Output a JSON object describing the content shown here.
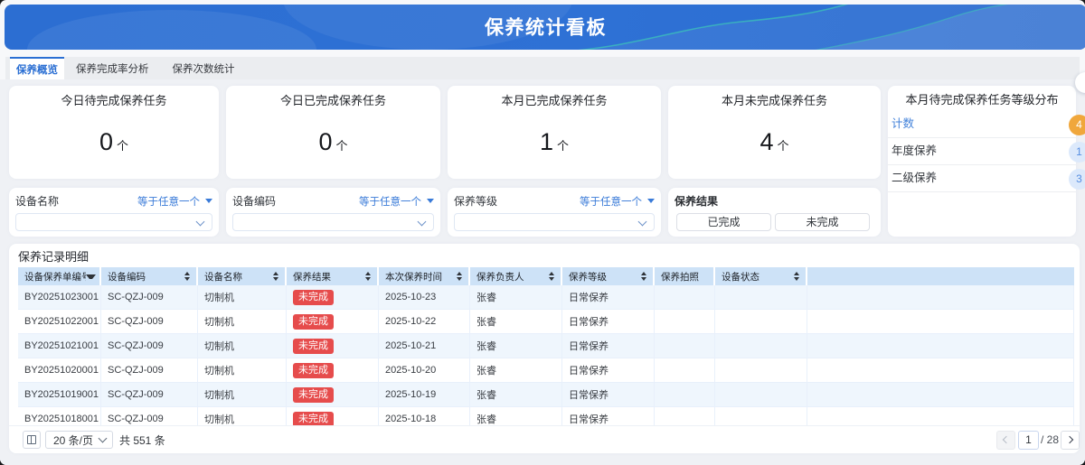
{
  "header": {
    "title": "保养统计看板"
  },
  "tabs": [
    {
      "label": "保养概览",
      "active": true
    },
    {
      "label": "保养完成率分析",
      "active": false
    },
    {
      "label": "保养次数统计",
      "active": false
    }
  ],
  "stats": [
    {
      "title": "今日待完成保养任务",
      "value": "0",
      "unit": "个"
    },
    {
      "title": "今日已完成保养任务",
      "value": "0",
      "unit": "个"
    },
    {
      "title": "本月已完成保养任务",
      "value": "1",
      "unit": "个"
    },
    {
      "title": "本月未完成保养任务",
      "value": "4",
      "unit": "个"
    }
  ],
  "distribution": {
    "title": "本月待完成保养任务等级分布",
    "rows": [
      {
        "label": "计数",
        "count": "4",
        "badge_color": "#f0a73c"
      },
      {
        "label": "年度保养",
        "count": "1",
        "badge_color": "#dce9fb"
      },
      {
        "label": "二级保养",
        "count": "3",
        "badge_color": "#dce9fb"
      }
    ]
  },
  "filters": [
    {
      "label": "设备名称",
      "operator": "等于任意一个",
      "value": ""
    },
    {
      "label": "设备编码",
      "operator": "等于任意一个",
      "value": ""
    },
    {
      "label": "保养等级",
      "operator": "等于任意一个",
      "value": ""
    }
  ],
  "result_filter": {
    "label": "保养结果",
    "buttons": [
      "已完成",
      "未完成"
    ]
  },
  "table": {
    "title": "保养记录明细",
    "columns": [
      {
        "label": "设备保养单编号",
        "sort_icon": "caret-down"
      },
      {
        "label": "设备编码",
        "sort_icon": "sort-both"
      },
      {
        "label": "设备名称",
        "sort_icon": "sort-both"
      },
      {
        "label": "保养结果",
        "sort_icon": "sort-both"
      },
      {
        "label": "本次保养时间",
        "sort_icon": "sort-both"
      },
      {
        "label": "保养负责人",
        "sort_icon": "sort-both"
      },
      {
        "label": "保养等级",
        "sort_icon": "sort-both"
      },
      {
        "label": "保养拍照",
        "sort_icon": "none"
      },
      {
        "label": "设备状态",
        "sort_icon": "sort-both"
      }
    ],
    "rows": [
      {
        "order_no": "BY20251023001",
        "device_code": "SC-QZJ-009",
        "device_name": "切制机",
        "result": "未完成",
        "time": "2025-10-23",
        "owner": "张睿",
        "level": "日常保养",
        "photo": "",
        "device_status": ""
      },
      {
        "order_no": "BY20251022001",
        "device_code": "SC-QZJ-009",
        "device_name": "切制机",
        "result": "未完成",
        "time": "2025-10-22",
        "owner": "张睿",
        "level": "日常保养",
        "photo": "",
        "device_status": ""
      },
      {
        "order_no": "BY20251021001",
        "device_code": "SC-QZJ-009",
        "device_name": "切制机",
        "result": "未完成",
        "time": "2025-10-21",
        "owner": "张睿",
        "level": "日常保养",
        "photo": "",
        "device_status": ""
      },
      {
        "order_no": "BY20251020001",
        "device_code": "SC-QZJ-009",
        "device_name": "切制机",
        "result": "未完成",
        "time": "2025-10-20",
        "owner": "张睿",
        "level": "日常保养",
        "photo": "",
        "device_status": ""
      },
      {
        "order_no": "BY20251019001",
        "device_code": "SC-QZJ-009",
        "device_name": "切制机",
        "result": "未完成",
        "time": "2025-10-19",
        "owner": "张睿",
        "level": "日常保养",
        "photo": "",
        "device_status": ""
      },
      {
        "order_no": "BY20251018001",
        "device_code": "SC-QZJ-009",
        "device_name": "切制机",
        "result": "未完成",
        "time": "2025-10-18",
        "owner": "张睿",
        "level": "日常保养",
        "photo": "",
        "device_status": ""
      }
    ],
    "result_badge_color": "#e64c4c"
  },
  "pagination": {
    "page_size": "20 条/页",
    "total": "共 551 条",
    "current_page": "1",
    "page_total": "/ 28"
  },
  "colors": {
    "accent_blue": "#2b6fd3",
    "header_gradient_blue": "#2d6fd3",
    "header_wave_teal": "#3ed0b4",
    "table_header_bg": "#cde2f7",
    "row_alt_bg": "#eff6fd",
    "badge_red": "#e64c4c",
    "badge_orange": "#f0a73c",
    "badge_light_blue_bg": "#dce9fb",
    "link_blue": "#3a7bd8"
  }
}
